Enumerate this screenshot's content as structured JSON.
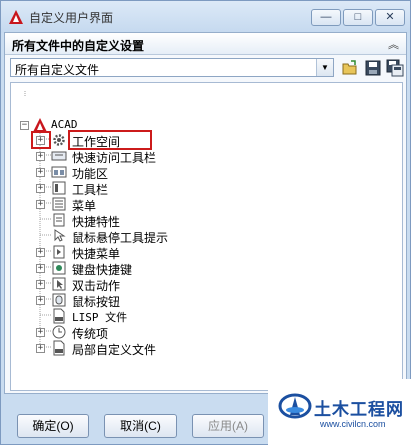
{
  "window": {
    "title": "自定义用户界面",
    "minimize_glyph": "—",
    "maximize_glyph": "□",
    "close_glyph": "✕"
  },
  "panel": {
    "title": "所有文件中的自定义设置",
    "collapse_glyph": "︽",
    "dropdown_value": "所有自定义文件",
    "dropdown_arrow": "▼"
  },
  "tree": {
    "root": {
      "label": "ACAD",
      "expander": "−"
    },
    "items": [
      {
        "label": "工作空间",
        "icon": "gear-icon",
        "expander": "+",
        "selected": true
      },
      {
        "label": "快速访问工具栏",
        "icon": "toolbar-icon",
        "expander": "+"
      },
      {
        "label": "功能区",
        "icon": "ribbon-icon",
        "expander": "+"
      },
      {
        "label": "工具栏",
        "icon": "toolbar-icon",
        "expander": "+"
      },
      {
        "label": "菜单",
        "icon": "menu-icon",
        "expander": "+"
      },
      {
        "label": "快捷特性",
        "icon": "properties-icon",
        "expander": ""
      },
      {
        "label": "鼠标悬停工具提示",
        "icon": "tooltip-icon",
        "expander": ""
      },
      {
        "label": "快捷菜单",
        "icon": "shortcut-menu-icon",
        "expander": "+"
      },
      {
        "label": "键盘快捷键",
        "icon": "keyboard-icon",
        "expander": "+"
      },
      {
        "label": "双击动作",
        "icon": "double-click-icon",
        "expander": "+"
      },
      {
        "label": "鼠标按钮",
        "icon": "mouse-icon",
        "expander": "+"
      },
      {
        "label": "LISP 文件",
        "icon": "lisp-file-icon",
        "expander": ""
      },
      {
        "label": "传统项",
        "icon": "legacy-icon",
        "expander": "+"
      },
      {
        "label": "局部自定义文件",
        "icon": "cui-file-icon",
        "expander": "+"
      }
    ]
  },
  "buttons": {
    "ok": "确定(O)",
    "cancel": "取消(C)",
    "apply": "应用(A)"
  },
  "watermark": {
    "title": "土木工程网",
    "url": "www.civilcn.com"
  },
  "colors": {
    "accent": "#cc1b1b",
    "window_bg": "#c9dcf0",
    "brand": "#1b4fa0"
  }
}
